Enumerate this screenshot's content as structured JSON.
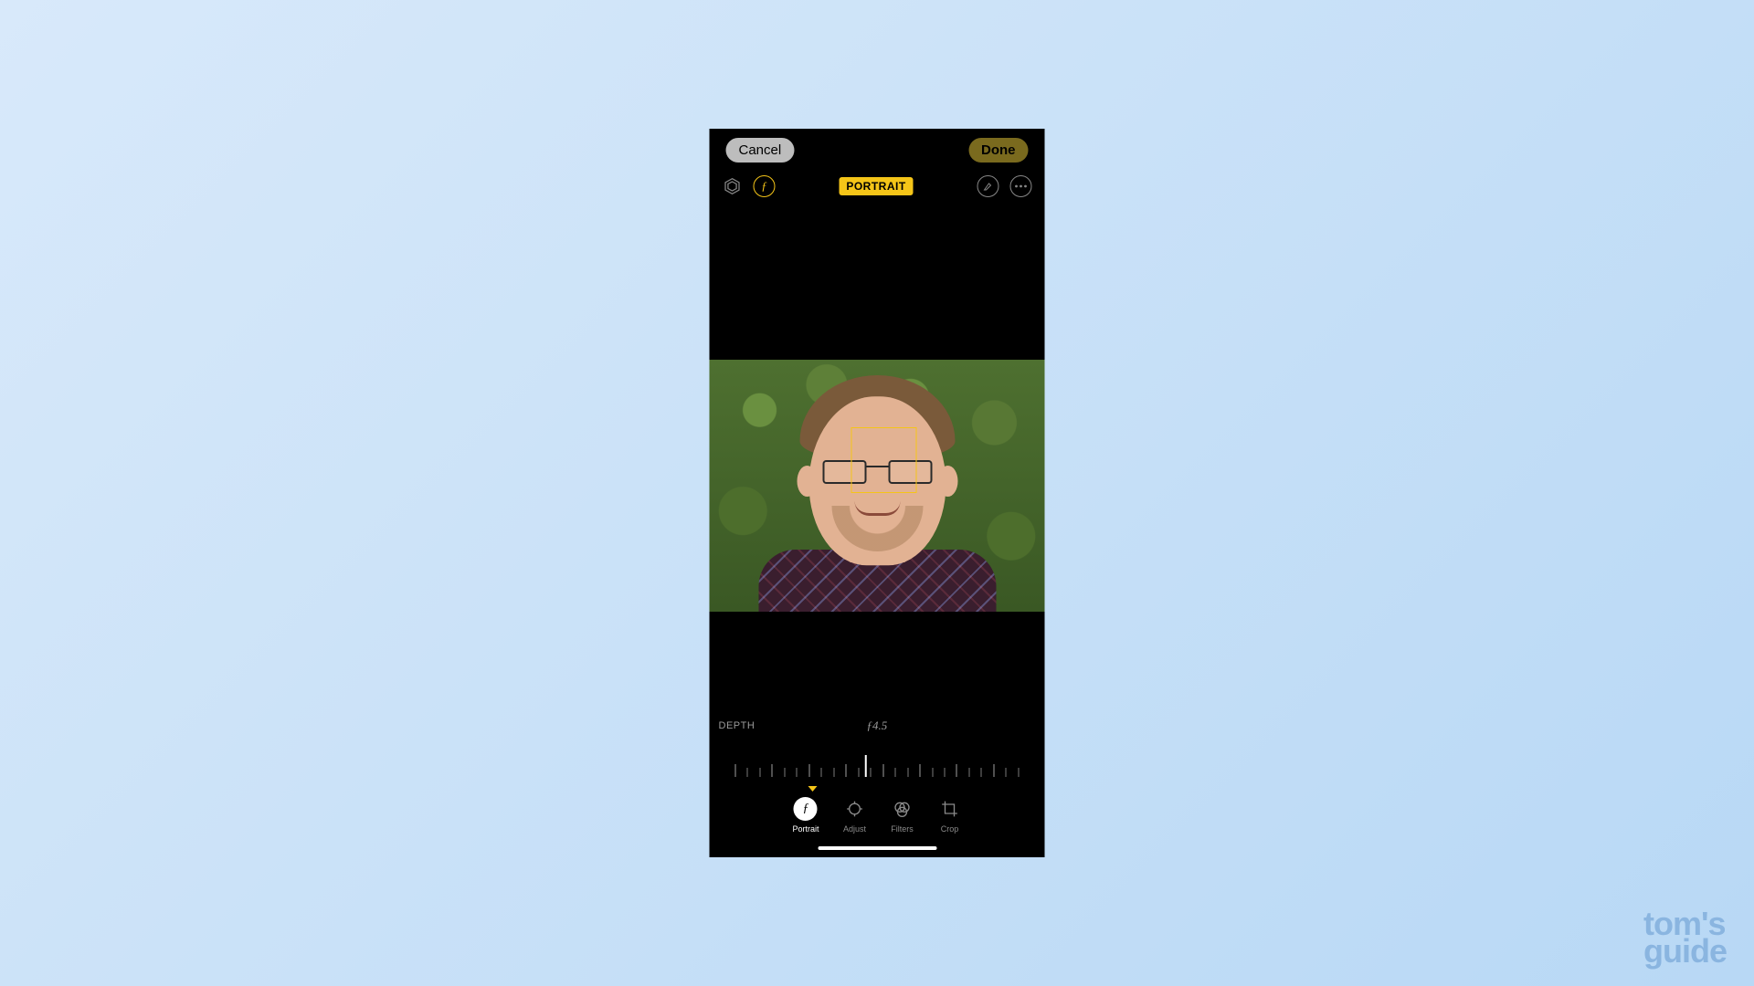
{
  "header": {
    "cancel_label": "Cancel",
    "done_label": "Done"
  },
  "toolbar": {
    "mode_badge": "PORTRAIT"
  },
  "depth": {
    "label": "DEPTH",
    "value": "ƒ4.5"
  },
  "tabs": [
    {
      "id": "portrait",
      "label": "Portrait",
      "active": true
    },
    {
      "id": "adjust",
      "label": "Adjust",
      "active": false
    },
    {
      "id": "filters",
      "label": "Filters",
      "active": false
    },
    {
      "id": "crop",
      "label": "Crop",
      "active": false
    }
  ],
  "watermark": {
    "line1": "tom's",
    "line2": "guide"
  },
  "colors": {
    "accent_yellow": "#f5c518"
  }
}
